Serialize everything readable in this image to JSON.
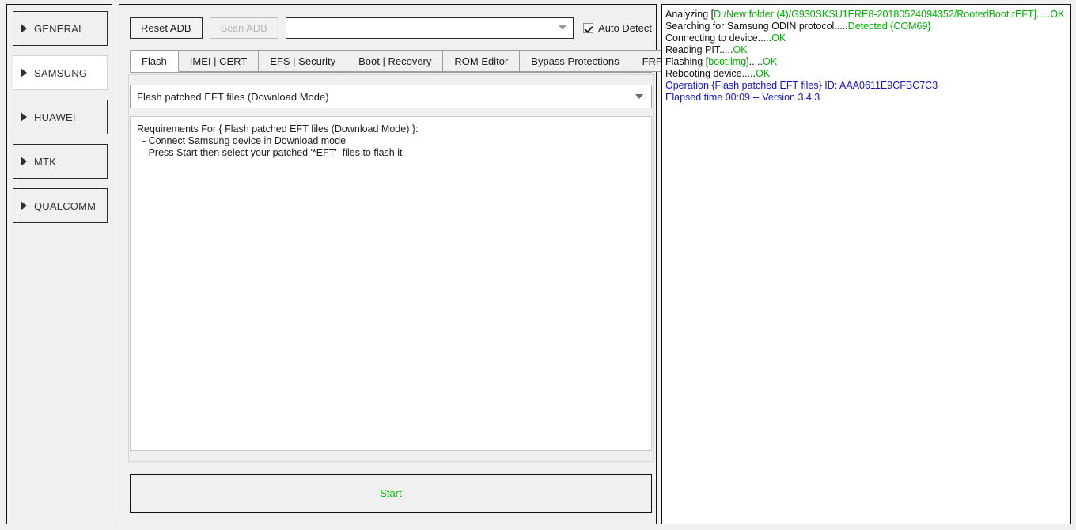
{
  "sidebar": {
    "items": [
      {
        "label": "GENERAL",
        "icon": "triangle-right-icon",
        "active": false
      },
      {
        "label": "SAMSUNG",
        "icon": "triangle-right-icon",
        "active": true
      },
      {
        "label": "HUAWEI",
        "icon": "triangle-right-icon",
        "active": false
      },
      {
        "label": "MTK",
        "icon": "triangle-right-icon",
        "active": false
      },
      {
        "label": "QUALCOMM",
        "icon": "triangle-right-icon",
        "active": false
      }
    ]
  },
  "toolbar": {
    "reset_adb_label": "Reset ADB",
    "scan_adb_label": "Scan ADB",
    "scan_adb_enabled": false,
    "device_combo_value": "",
    "device_combo_placeholder": "",
    "auto_detect_label": "Auto Detect",
    "auto_detect_checked": true
  },
  "tabs": [
    {
      "label": "Flash",
      "active": true
    },
    {
      "label": "IMEI | CERT",
      "active": false
    },
    {
      "label": "EFS | Security",
      "active": false
    },
    {
      "label": "Boot | Recovery",
      "active": false
    },
    {
      "label": "ROM Editor",
      "active": false
    },
    {
      "label": "Bypass Protections",
      "active": false
    },
    {
      "label": "FRP",
      "active": false
    }
  ],
  "operation": {
    "selected": "Flash patched EFT files (Download Mode)",
    "requirements": [
      "Requirements For { Flash patched EFT files (Download Mode) }:",
      "  - Connect Samsung device in Download mode",
      "  - Press Start then select your patched '*EFT'  files to flash it"
    ]
  },
  "start_button": {
    "label": "Start",
    "color": "#00c000"
  },
  "log": {
    "colors": {
      "normal": "#111111",
      "success": "#00b200",
      "info": "#1414d2"
    },
    "lines": [
      [
        {
          "t": "Analyzing [",
          "c": "normal"
        },
        {
          "t": "D:/New folder (4)/G930SKSU1ERE8-20180524094352/RootedBoot.rEFT].....OK",
          "c": "success"
        }
      ],
      [
        {
          "t": "Searching for Samsung ODIN protocol.....",
          "c": "normal"
        },
        {
          "t": "Detected {COM69}",
          "c": "success"
        }
      ],
      [
        {
          "t": "Connecting to device.....",
          "c": "normal"
        },
        {
          "t": "OK",
          "c": "success"
        }
      ],
      [
        {
          "t": "Reading PIT.....",
          "c": "normal"
        },
        {
          "t": "OK",
          "c": "success"
        }
      ],
      [
        {
          "t": "Flashing [",
          "c": "normal"
        },
        {
          "t": "boot.img",
          "c": "success"
        },
        {
          "t": "].....",
          "c": "normal"
        },
        {
          "t": "OK",
          "c": "success"
        }
      ],
      [
        {
          "t": "Rebooting device.....",
          "c": "normal"
        },
        {
          "t": "OK",
          "c": "success"
        }
      ],
      [
        {
          "t": "Operation {Flash patched EFT files} ID: AAA0611E9CFBC7C3",
          "c": "info"
        }
      ],
      [
        {
          "t": "Elapsed time 00:09 -- Version 3.4.3",
          "c": "info"
        }
      ]
    ]
  }
}
